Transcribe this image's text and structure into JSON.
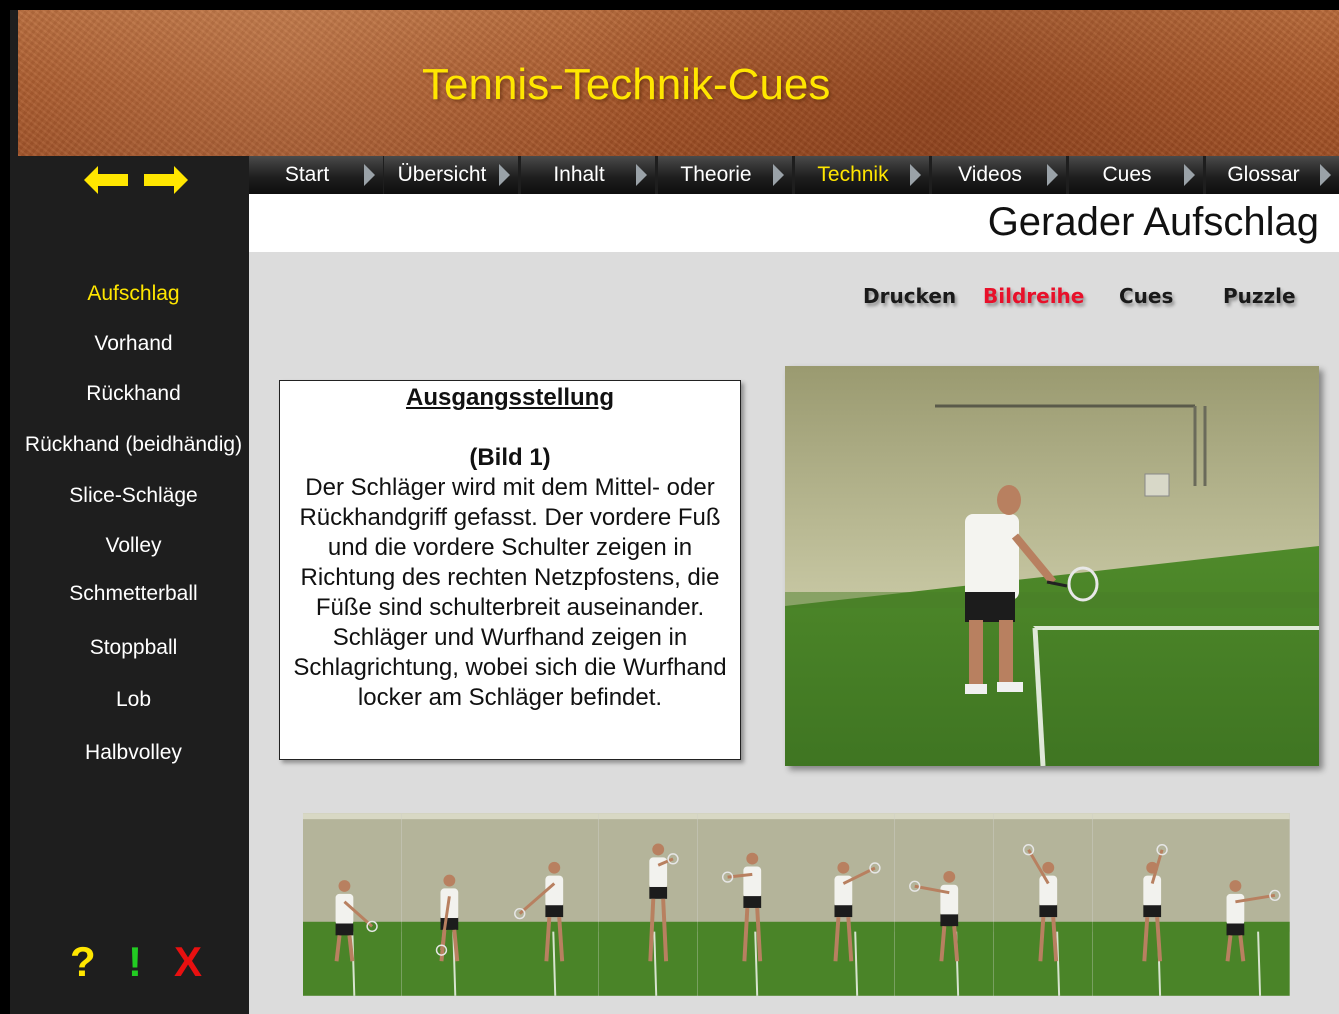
{
  "header": {
    "title": "Tennis-Technik-Cues"
  },
  "nav": {
    "tabs": [
      {
        "label": "Start"
      },
      {
        "label": "Übersicht"
      },
      {
        "label": "Inhalt"
      },
      {
        "label": "Theorie"
      },
      {
        "label": "Technik",
        "active": true
      },
      {
        "label": "Videos"
      },
      {
        "label": "Cues"
      },
      {
        "label": "Glossar"
      }
    ]
  },
  "page": {
    "title": "Gerader Aufschlag"
  },
  "sidebar": {
    "items": [
      {
        "label": "Aufschlag",
        "active": true
      },
      {
        "label": "Vorhand"
      },
      {
        "label": "Rückhand"
      },
      {
        "label": "Rückhand (beidhändig)"
      },
      {
        "label": "Slice-Schläge"
      },
      {
        "label": "Volley"
      },
      {
        "label": "Schmetterball"
      },
      {
        "label": "Stoppball"
      },
      {
        "label": "Lob"
      },
      {
        "label": "Halbvolley"
      }
    ],
    "help": {
      "question": "?",
      "exclaim": "!",
      "close": "X"
    }
  },
  "actions": {
    "print": "Drucken",
    "series": "Bildreihe",
    "cues": "Cues",
    "puzzle": "Puzzle"
  },
  "description": {
    "heading": "Ausgangsstellung",
    "subheading": "(Bild 1)",
    "body": "Der Schläger wird mit dem Mittel- oder Rückhandgriff gefasst. Der vordere Fuß und die vordere Schulter zeigen in Richtung des rechten Netzpfostens, die Füße sind schulterbreit auseinander. Schläger und Wurfhand zeigen in Schlagrichtung, wobei sich die Wurfhand locker am Schläger befindet."
  },
  "colors": {
    "accent_yellow": "#ffe600",
    "active_red": "#e8102a",
    "help_green": "#22cc22",
    "help_red": "#e81010"
  },
  "strip_frames": 10
}
